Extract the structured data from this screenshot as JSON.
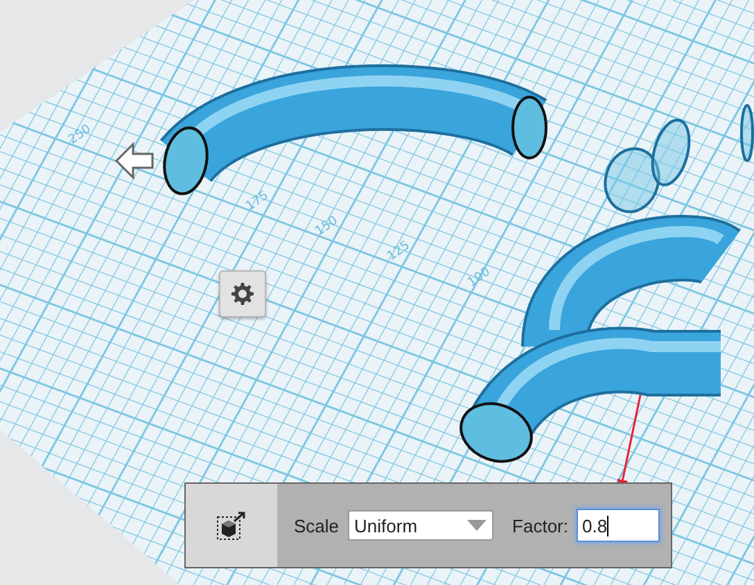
{
  "viewport": {
    "grid_labels": [
      "250",
      "175",
      "150",
      "125",
      "100"
    ]
  },
  "toolbar": {
    "scale_label": "Scale",
    "scale_mode": "Uniform",
    "factor_label": "Factor:",
    "factor_value": "0.8",
    "factor_focused": true
  }
}
